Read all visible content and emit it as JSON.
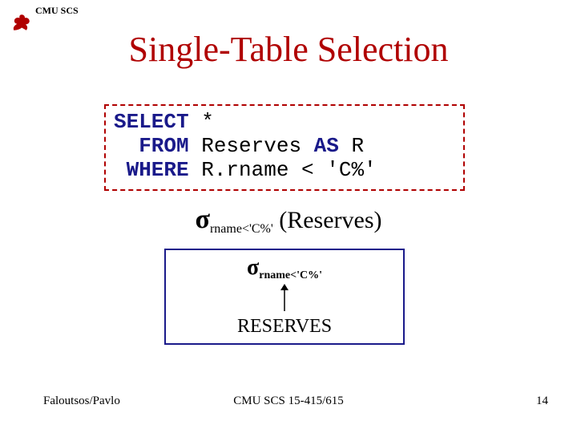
{
  "header": {
    "org": "CMU SCS"
  },
  "title": "Single-Table Selection",
  "sql": {
    "kw_select": "SELECT",
    "select_rest": " *",
    "kw_from": "  FROM",
    "from_rest1": " Reserves ",
    "kw_as": "AS",
    "from_rest2": " R",
    "kw_where": " WHERE",
    "where_rest": " R.rname < 'C%'"
  },
  "ra": {
    "sigma": "σ",
    "subscript": "rname<'C%'",
    "operand_open": " (",
    "operand": "Reserves",
    "operand_close": ")"
  },
  "tree": {
    "sigma": "σ",
    "subscript": "rname<'C%'",
    "table": "RESERVES"
  },
  "footer": {
    "left": "Faloutsos/Pavlo",
    "center": "CMU SCS 15-415/615",
    "right": "14"
  }
}
